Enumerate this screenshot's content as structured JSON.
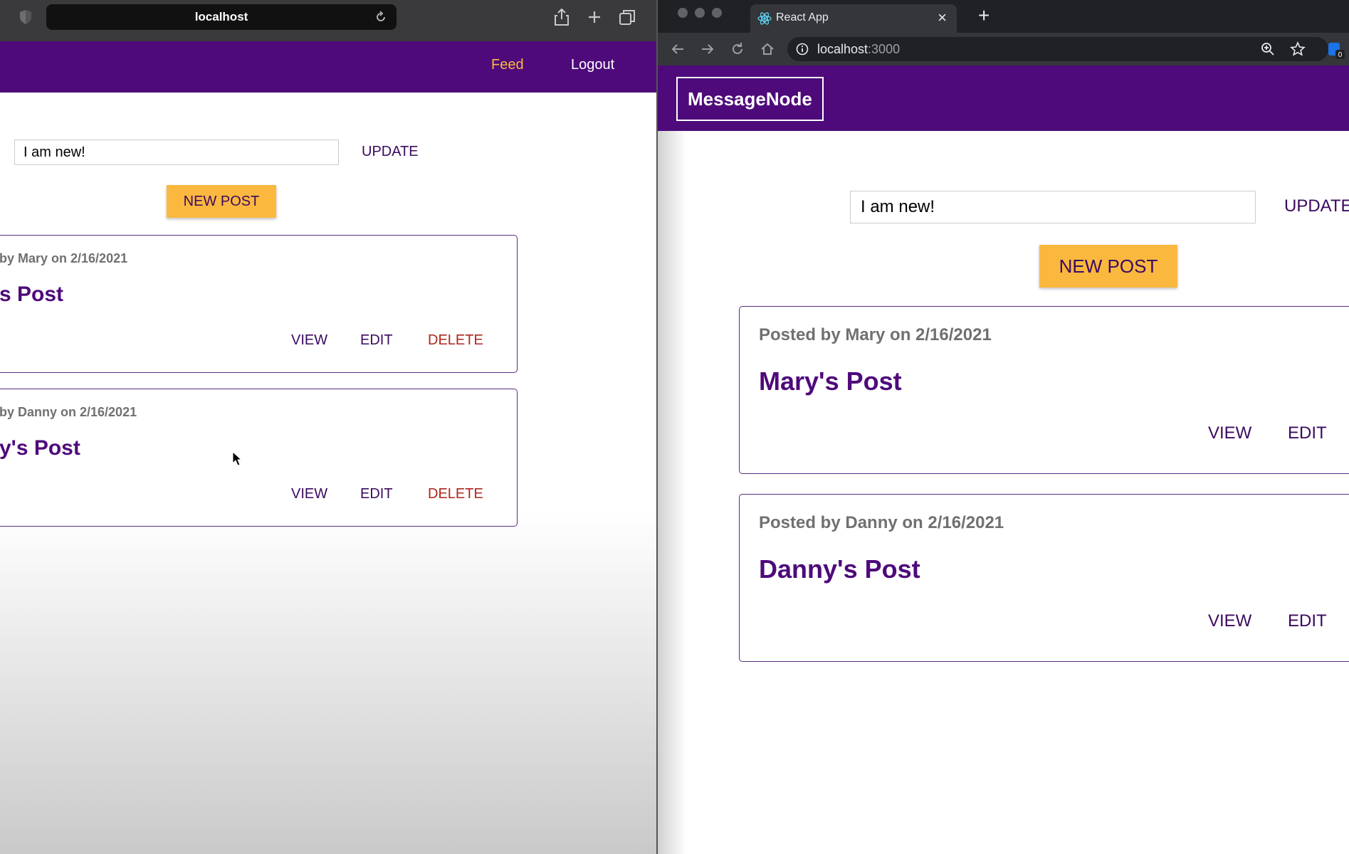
{
  "left_window": {
    "url": "localhost",
    "nav": {
      "feed_label": "Feed",
      "logout_label": "Logout"
    },
    "status": {
      "value": "I am new!",
      "update_label": "UPDATE"
    },
    "new_post_label": "NEW POST",
    "posts": [
      {
        "meta": "by Mary on 2/16/2021",
        "title": "s Post",
        "view": "VIEW",
        "edit": "EDIT",
        "delete": "DELETE"
      },
      {
        "meta": "by Danny on 2/16/2021",
        "title": "y's Post",
        "view": "VIEW",
        "edit": "EDIT",
        "delete": "DELETE"
      }
    ]
  },
  "right_window": {
    "tab_title": "React App",
    "url_host": "localhost",
    "url_port": ":3000",
    "extension_badge": "0",
    "logo": "MessageNode",
    "status": {
      "value": "I am new!",
      "update_label": "UPDATE"
    },
    "new_post_label": "NEW POST",
    "posts": [
      {
        "meta": "Posted by Mary on 2/16/2021",
        "title": "Mary's Post",
        "view": "VIEW",
        "edit": "EDIT"
      },
      {
        "meta": "Posted by Danny on 2/16/2021",
        "title": "Danny's Post",
        "view": "VIEW",
        "edit": "EDIT"
      }
    ]
  },
  "colors": {
    "brand_purple": "#4e0a7a",
    "accent_yellow": "#fab83f",
    "feed_link": "#fab83f",
    "delete_red": "#b0261c"
  }
}
